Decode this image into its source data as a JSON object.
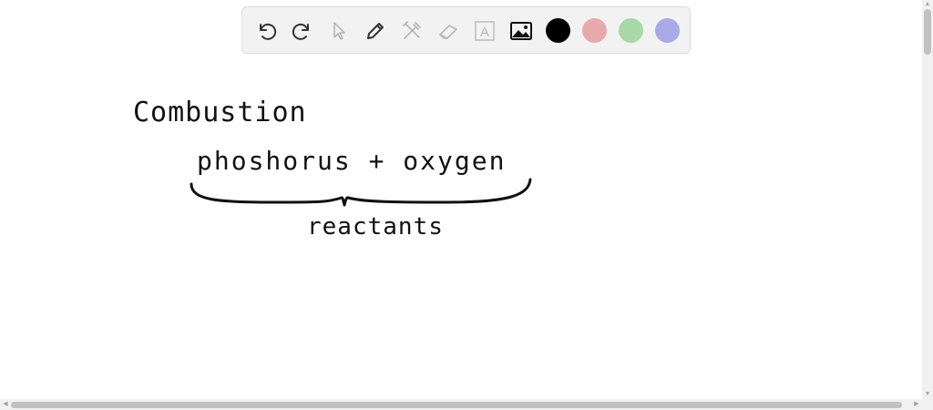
{
  "toolbar": {
    "tools": [
      {
        "name": "undo-icon"
      },
      {
        "name": "redo-icon"
      },
      {
        "name": "select-pointer-icon"
      },
      {
        "name": "pen-icon"
      },
      {
        "name": "tools-icon"
      },
      {
        "name": "eraser-icon"
      },
      {
        "name": "text-icon"
      },
      {
        "name": "image-icon"
      }
    ],
    "text_tool_glyph": "A",
    "colors": [
      "#000000",
      "#e8a9ad",
      "#a9d8a9",
      "#a9a9e8"
    ]
  },
  "canvas": {
    "heading": "Combustion",
    "equation": "phoshorus + oxygen",
    "label": "reactants"
  },
  "scrollbar": {
    "up_arrow": "▲",
    "down_arrow": "▼",
    "left_arrow": "◀",
    "right_arrow": "▶"
  }
}
